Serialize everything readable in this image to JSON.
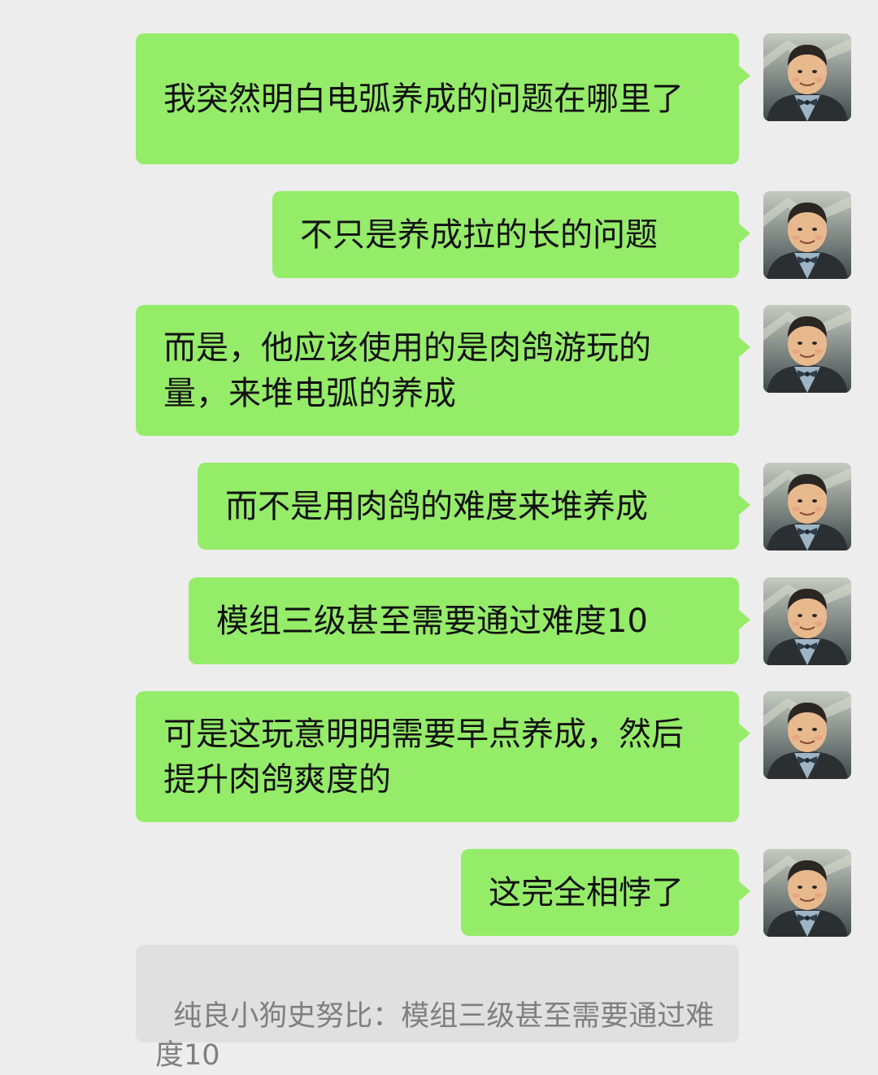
{
  "messages": [
    {
      "text": "我突然明白电弧养成的问题在哪里了"
    },
    {
      "text": "不只是养成拉的长的问题"
    },
    {
      "text": "而是，他应该使用的是肉鸽游玩的量，来堆电弧的养成"
    },
    {
      "text": "而不是用肉鸽的难度来堆养成"
    },
    {
      "text": "模组三级甚至需要通过难度10"
    },
    {
      "text": "可是这玩意明明需要早点养成，然后提升肉鸽爽度的"
    },
    {
      "text": "这完全相悖了"
    }
  ],
  "quote": {
    "text": "纯良小狗史努比：模组三级甚至需要通过难度10"
  },
  "avatar": {
    "icon": "cartoon-man-bowtie-avatar",
    "colors": {
      "bg_top": "#c5cbbf",
      "bg_bottom": "#3f4a4d",
      "skin": "#e9b98e",
      "hair": "#2a2623",
      "jacket": "#2c2f31",
      "shirt": "#9fb4c4",
      "bowtie": "#2f3c49"
    }
  },
  "theme": {
    "background": "#ededed",
    "bubble": "#95ec69",
    "quote_bg": "#e0e0e0",
    "quote_text": "#7f7f7f"
  }
}
